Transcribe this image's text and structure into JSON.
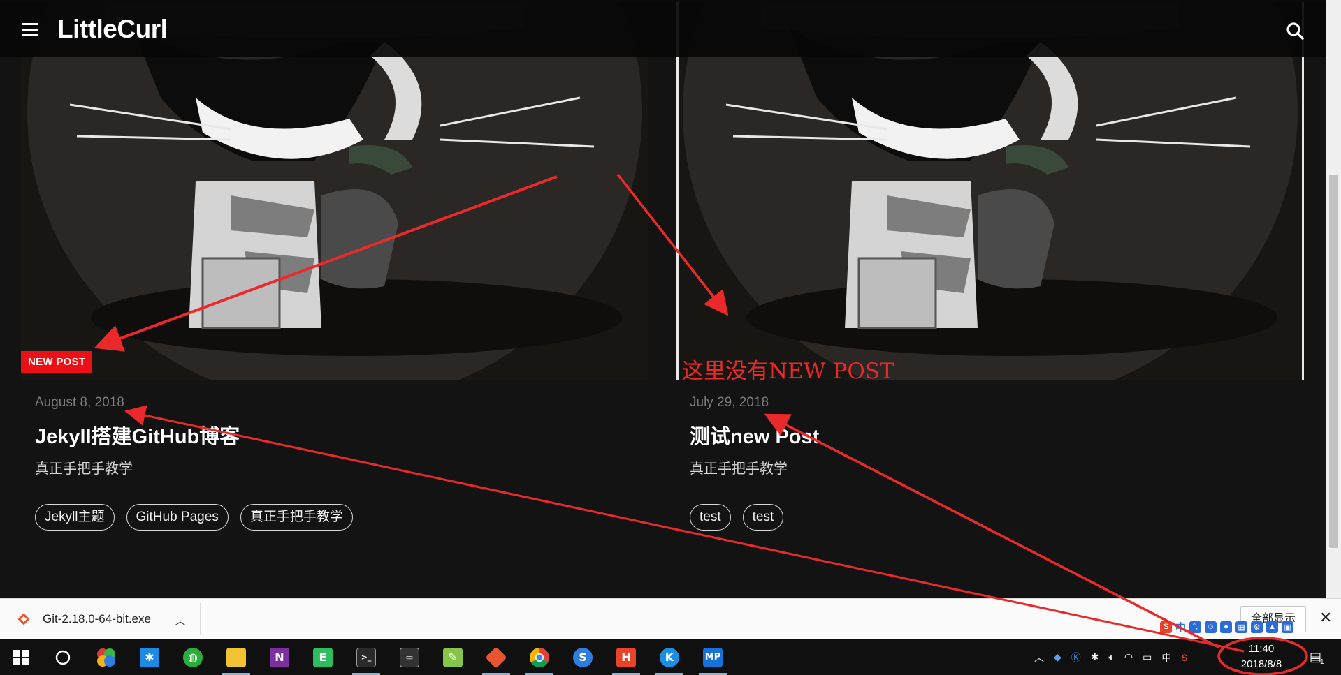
{
  "site": {
    "title": "LittleCurl"
  },
  "posts": [
    {
      "badge": "NEW POST",
      "date": "August 8, 2018",
      "title": "Jekyll搭建GitHub博客",
      "subtitle": "真正手把手教学",
      "tags": [
        "Jekyll主题",
        "GitHub Pages",
        "真正手把手教学"
      ]
    },
    {
      "date": "July 29, 2018",
      "title": "测试new Post",
      "subtitle": "真正手把手教学",
      "tags": [
        "test",
        "test"
      ]
    }
  ],
  "annotation": {
    "text": "这里没有NEW POST"
  },
  "download_bar": {
    "file_name": "Git-2.18.0-64-bit.exe",
    "show_all_label": "全部显示"
  },
  "taskbar": {
    "apps": [
      "start",
      "search",
      "pinwheel",
      "star",
      "wechat",
      "file-explorer",
      "onenote",
      "evernote",
      "terminal",
      "terminal-2",
      "notepad",
      "git",
      "chrome",
      "sogou",
      "hbuilder",
      "kugou",
      "mp"
    ],
    "tray_lang": "中",
    "time": "11:40",
    "date": "2018/8/8",
    "notification_count": "1"
  },
  "ime": {
    "lang": "中"
  },
  "colors": {
    "badge": "#ea1016",
    "annotation": "#ea2a2a",
    "page_bg": "#131313"
  }
}
